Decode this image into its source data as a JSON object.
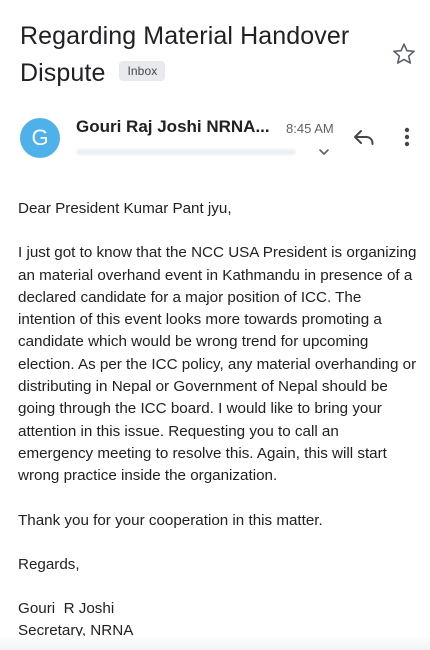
{
  "email": {
    "subject": "Regarding Material Handover Dispute",
    "label": "Inbox",
    "sender_initial": "G",
    "sender_name": "Gouri Raj Joshi NRNA...",
    "time": "8:45 AM"
  },
  "message": {
    "greeting": "Dear President Kumar Pant jyu,",
    "paragraph": "I just got to know that the NCC USA President is organizing an material overhand event in Kathmandu in presence of a declared candidate for a major position of ICC. The intention of this event looks more towards promoting a candidate which would be wrong trend for upcoming election. As per the ICC policy, any material overhanding or distributing in Nepal or Government of Nepal should be going through the ICC board. I would like to bring your attention in this issue. Requesting you to call an emergency meeting to resolve this. Again, this will start wrong practice inside the organization.",
    "thanks": "Thank you for your cooperation in this matter.",
    "regards": "Regards,",
    "signature_name": "Gouri  R Joshi",
    "signature_title": "Secretary, NRNA"
  },
  "icons": {
    "star": "star-outline-icon",
    "reply": "reply-icon",
    "more": "more-vert-icon",
    "expand": "chevron-down-icon"
  },
  "colors": {
    "avatar": "#4fb1e9",
    "text": "#202124",
    "secondary": "#5f6368",
    "label_bg": "#e8eaed"
  }
}
